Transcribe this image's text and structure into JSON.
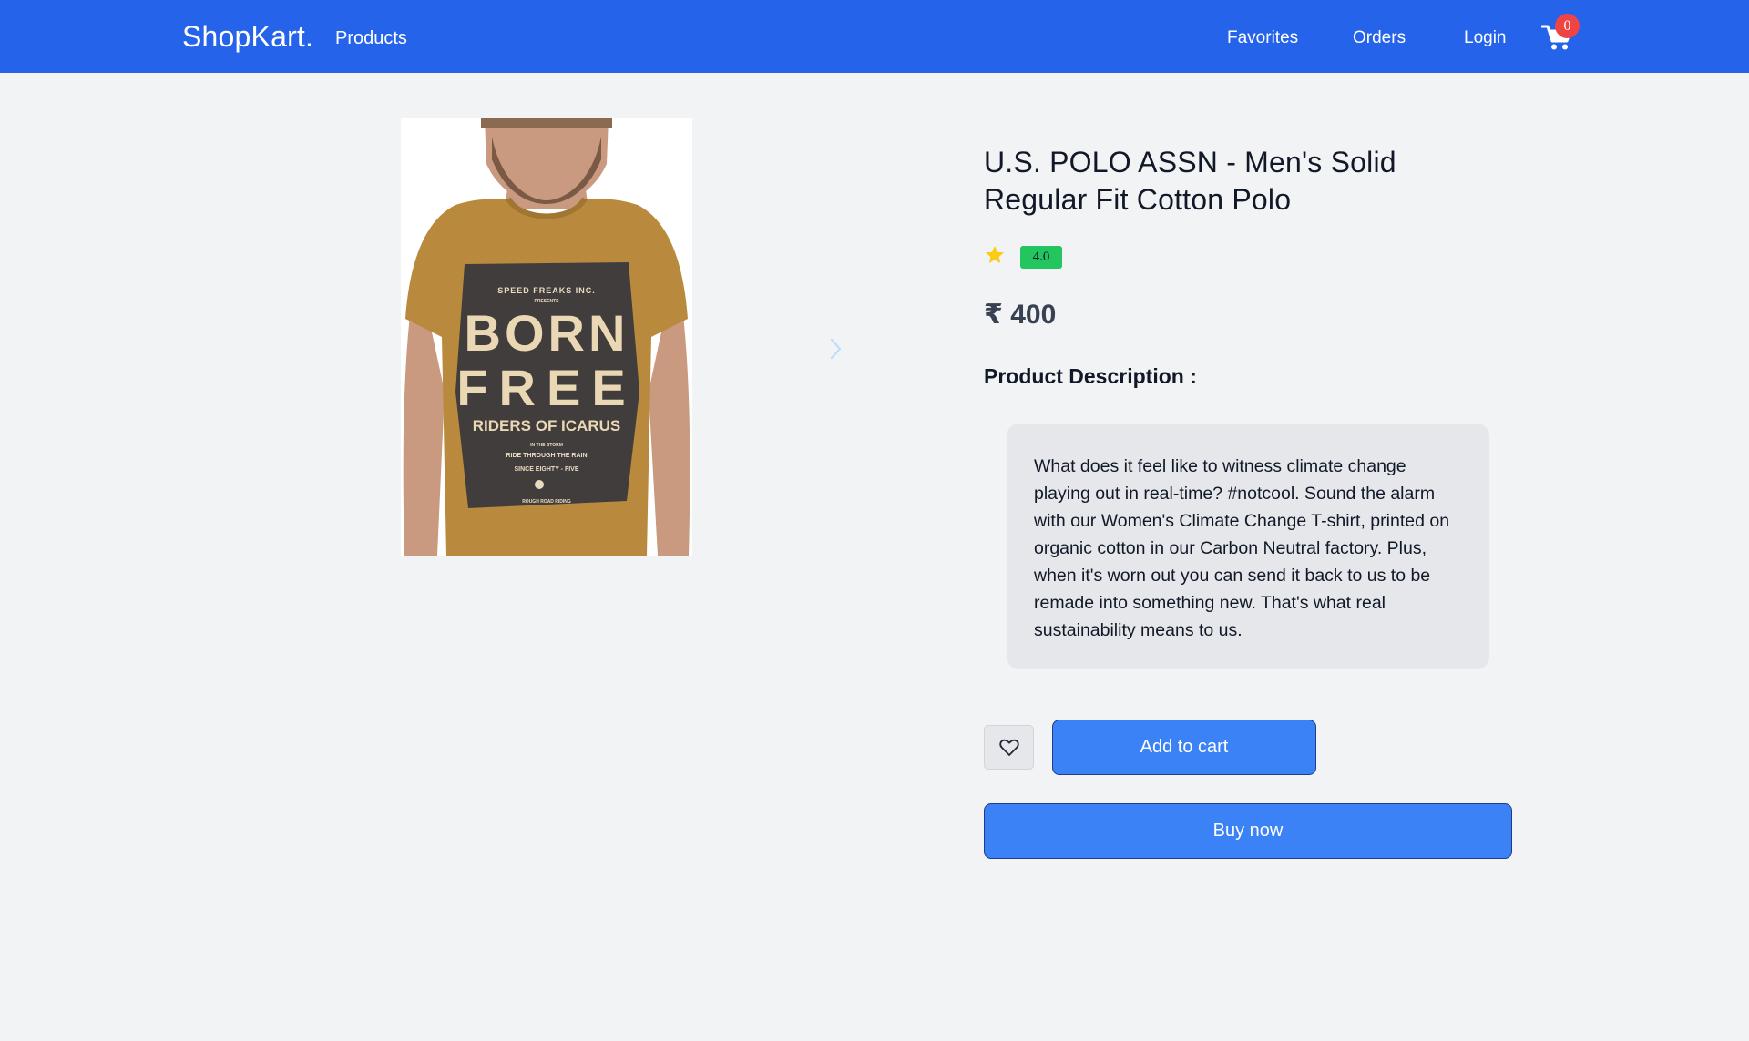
{
  "header": {
    "brand": "ShopKart.",
    "nav_products": "Products",
    "nav_favorites": "Favorites",
    "nav_orders": "Orders",
    "nav_login": "Login",
    "cart_count": "0",
    "bg_color": "#2563eb",
    "cart_icon": "shopping-cart-icon"
  },
  "product": {
    "image_text": {
      "brand_line": "SPEED FREAKS INC.",
      "presents": "PRESENTS",
      "line1": "BORN",
      "line2": "FREE",
      "line3": "RIDERS OF ICARUS",
      "small1": "IN THE STORM",
      "small2": "RIDE THROUGH THE RAIN",
      "small3": "SINCE EIGHTY - FIVE",
      "small4": "ROUGH ROAD RIDING"
    },
    "title": "U.S. POLO ASSN - Men's Solid Regular Fit Cotton Polo",
    "rating": "4.0",
    "price": "₹ 400",
    "description_heading": "Product Description :",
    "description": "What does it feel like to witness climate change playing out in real-time? #notcool. Sound the alarm with our Women's Climate Change T-shirt, printed on organic cotton in our Carbon Neutral factory. Plus, when it's worn out you can send it back to us to be remade into something new. That's what real sustainability means to us."
  },
  "actions": {
    "add_to_cart": "Add to cart",
    "buy_now": "Buy now",
    "accent_color": "#3b82f6",
    "favorite_icon": "heart-icon"
  }
}
